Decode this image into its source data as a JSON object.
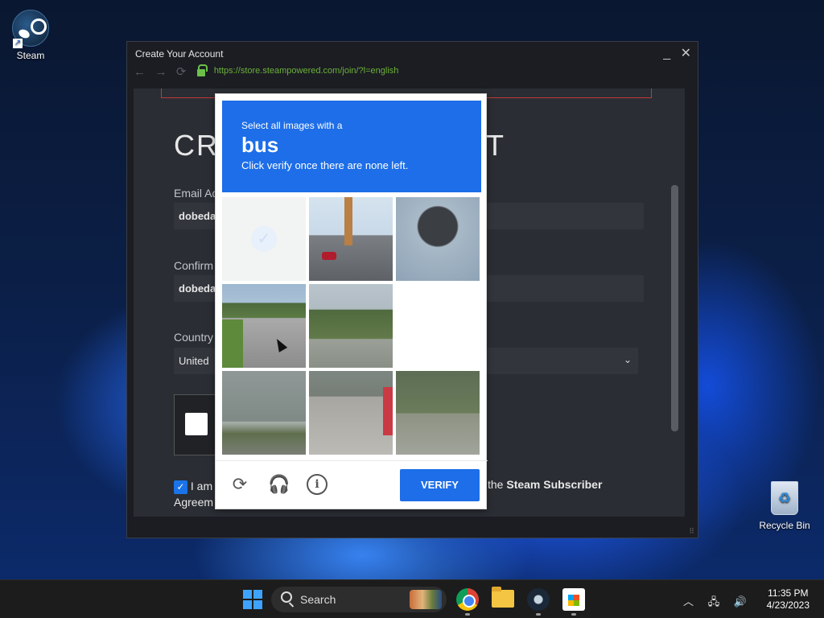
{
  "desktop": {
    "icons": [
      {
        "label": "Steam",
        "icon": "steam-icon"
      },
      {
        "label": "Recycle Bin",
        "icon": "recycle-bin-icon"
      }
    ]
  },
  "window": {
    "title": "Create Your Account",
    "controls": {
      "minimize": "_",
      "close": "✕"
    },
    "nav": {
      "back": "←",
      "forward": "→",
      "reload": "⟳"
    },
    "url": "https://store.steampowered.com/join/?l=english"
  },
  "form": {
    "heading_left": "CRE",
    "heading_right": "NT",
    "email_label": "Email Ad",
    "email_value": "dobeda",
    "confirm_label": "Confirm",
    "confirm_value": "dobeda",
    "country_label": "Country",
    "country_value": "United",
    "agree_prefix": "I am",
    "agree_tail": "the",
    "agree_link": "Steam Subscriber",
    "agree_line2": "Agreem"
  },
  "captcha": {
    "prompt_small": "Select all images with a",
    "prompt_object": "bus",
    "prompt_instruction": "Click verify once there are none left.",
    "verify_label": "VERIFY",
    "tiles": [
      "selected",
      "bridge",
      "tire",
      "road",
      "trees",
      "blank",
      "grass",
      "street",
      "shrub"
    ]
  },
  "taskbar": {
    "search_label": "Search",
    "time": "11:35 PM",
    "date": "4/23/2023"
  },
  "colors": {
    "captcha_blue": "#1d6ee8",
    "url_green": "#6cb03a",
    "steam_bg": "#2a2d33"
  }
}
